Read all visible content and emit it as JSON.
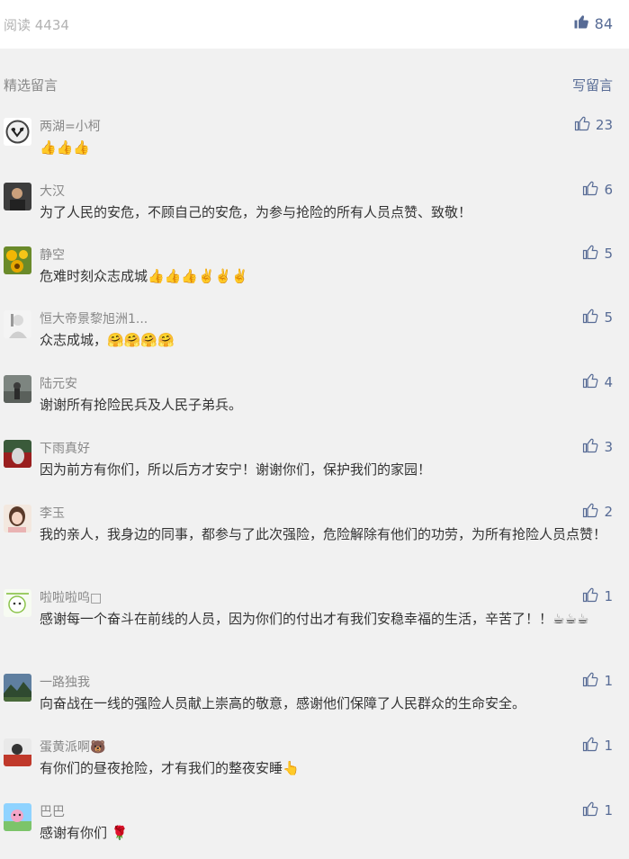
{
  "header": {
    "read_label": "阅读 4434",
    "like_count": "84"
  },
  "section": {
    "title": "精选留言",
    "write_label": "写留言"
  },
  "comments": [
    {
      "nick": "两湖=小柯",
      "text": "👍👍👍",
      "likes": "23"
    },
    {
      "nick": "大汉",
      "text": "为了人民的安危，不顾自己的安危，为参与抢险的所有人员点赞、致敬！",
      "likes": "6"
    },
    {
      "nick": "静空",
      "text": "危难时刻众志成城👍👍👍✌️✌️✌️",
      "likes": "5"
    },
    {
      "nick": "恒大帝景黎旭洲1...",
      "text": "众志成城，🤗🤗🤗🤗",
      "likes": "5"
    },
    {
      "nick": "陆元安",
      "text": "谢谢所有抢险民兵及人民子弟兵。",
      "likes": "4"
    },
    {
      "nick": "下雨真好",
      "text": "因为前方有你们，所以后方才安宁！谢谢你们，保护我们的家园！",
      "likes": "3"
    },
    {
      "nick": "李玉",
      "text": "我的亲人，我身边的同事，都参与了此次强险，危险解除有他们的功劳，为所有抢险人员点赞！",
      "likes": "2"
    },
    {
      "nick": "啦啦啦呜□",
      "text": "感谢每一个奋斗在前线的人员，因为你们的付出才有我们安稳幸福的生活，辛苦了！！☕☕☕",
      "likes": "1"
    },
    {
      "nick": "一路独我",
      "text": "向奋战在一线的强险人员献上崇高的敬意，感谢他们保障了人民群众的生命安全。",
      "likes": "1"
    },
    {
      "nick": "蛋黄派啊🐻",
      "text": "有你们的昼夜抢险，才有我们的整夜安睡👆",
      "likes": "1"
    },
    {
      "nick": "巴巴",
      "text": "感谢有你们 🌹",
      "likes": "1"
    }
  ]
}
